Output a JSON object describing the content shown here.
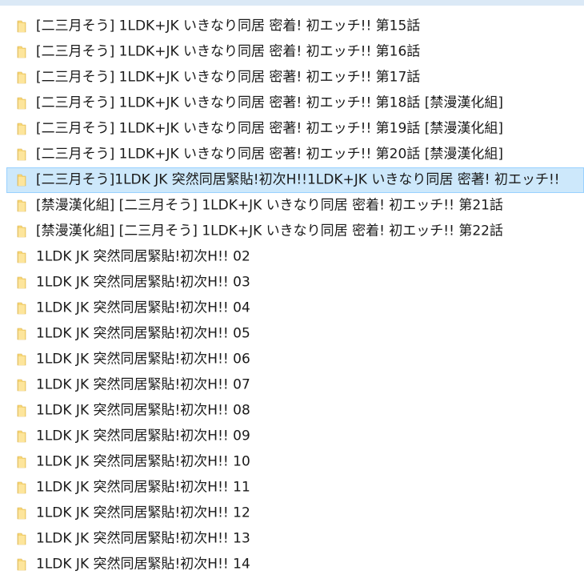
{
  "explorer": {
    "items": [
      {
        "name": "[二三月そう] 1LDK+JK いきなり同居 密着! 初エッチ!! 第15話",
        "icon": "folder-icon",
        "selected": false
      },
      {
        "name": "[二三月そう] 1LDK+JK いきなり同居 密着! 初エッチ!! 第16話",
        "icon": "folder-icon",
        "selected": false
      },
      {
        "name": "[二三月そう] 1LDK+JK いきなり同居 密著! 初エッチ!! 第17話",
        "icon": "folder-icon",
        "selected": false
      },
      {
        "name": "[二三月そう] 1LDK+JK いきなり同居 密著! 初エッチ!! 第18話 [禁漫漢化組]",
        "icon": "folder-icon",
        "selected": false
      },
      {
        "name": "[二三月そう] 1LDK+JK いきなり同居 密著! 初エッチ!! 第19話 [禁漫漢化組]",
        "icon": "folder-icon",
        "selected": false
      },
      {
        "name": "[二三月そう] 1LDK+JK いきなり同居 密著! 初エッチ!! 第20話 [禁漫漢化組]",
        "icon": "folder-icon",
        "selected": false
      },
      {
        "name": "[二三月そう]1LDK JK 突然同居緊貼!初次H!!1LDK+JK いきなり同居 密著! 初エッチ!!",
        "icon": "folder-icon",
        "selected": true
      },
      {
        "name": "[禁漫漢化組] [二三月そう] 1LDK+JK いきなり同居 密着! 初エッチ!! 第21話",
        "icon": "folder-icon",
        "selected": false
      },
      {
        "name": "[禁漫漢化組] [二三月そう] 1LDK+JK いきなり同居 密着! 初エッチ!! 第22話",
        "icon": "folder-icon",
        "selected": false
      },
      {
        "name": "1LDK JK 突然同居緊貼!初次H!! 02",
        "icon": "folder-icon",
        "selected": false
      },
      {
        "name": "1LDK JK 突然同居緊貼!初次H!! 03",
        "icon": "folder-icon",
        "selected": false
      },
      {
        "name": "1LDK JK 突然同居緊貼!初次H!! 04",
        "icon": "folder-icon",
        "selected": false
      },
      {
        "name": "1LDK JK 突然同居緊貼!初次H!! 05",
        "icon": "folder-icon",
        "selected": false
      },
      {
        "name": "1LDK JK 突然同居緊貼!初次H!! 06",
        "icon": "folder-icon",
        "selected": false
      },
      {
        "name": "1LDK JK 突然同居緊貼!初次H!! 07",
        "icon": "folder-icon",
        "selected": false
      },
      {
        "name": "1LDK JK 突然同居緊貼!初次H!! 08",
        "icon": "folder-icon",
        "selected": false
      },
      {
        "name": "1LDK JK 突然同居緊貼!初次H!! 09",
        "icon": "folder-icon",
        "selected": false
      },
      {
        "name": "1LDK JK 突然同居緊貼!初次H!! 10",
        "icon": "folder-icon",
        "selected": false
      },
      {
        "name": "1LDK JK 突然同居緊貼!初次H!! 11",
        "icon": "folder-icon",
        "selected": false
      },
      {
        "name": "1LDK JK 突然同居緊貼!初次H!! 12",
        "icon": "folder-icon",
        "selected": false
      },
      {
        "name": "1LDK JK 突然同居緊貼!初次H!! 13",
        "icon": "folder-icon",
        "selected": false
      },
      {
        "name": "1LDK JK 突然同居緊貼!初次H!! 14",
        "icon": "folder-icon",
        "selected": false
      }
    ]
  },
  "colors": {
    "folder_body": "#f8d775",
    "folder_front": "#fde59c",
    "folder_edge": "#dcb654",
    "selection_bg": "#cde8fb",
    "selection_border": "#99d1ff",
    "header_strip": "#dbe9f6"
  }
}
